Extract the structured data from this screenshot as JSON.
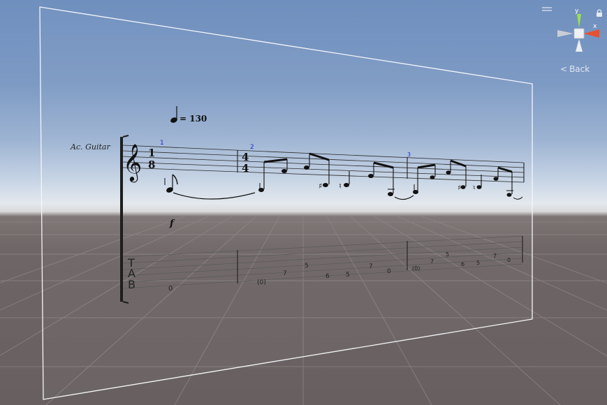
{
  "score": {
    "tempo_value": "= 130",
    "instrument_label": "Ac. Guitar",
    "first_time_signature": {
      "top": "1",
      "bottom": "8"
    },
    "second_time_signature": {
      "top": "4",
      "bottom": "4"
    },
    "measure_numbers": [
      "1",
      "2",
      "3"
    ],
    "dynamic_marking": "f",
    "tab_clef_letters": [
      "T",
      "A",
      "B"
    ],
    "tab_numbers_measure1": [
      "0"
    ],
    "tab_numbers_measure2": [
      "(0)",
      "7",
      "5",
      "6",
      "5",
      "7",
      "0"
    ],
    "tab_numbers_measure3": [
      "(0)",
      "7",
      "5",
      "6",
      "5",
      "7",
      "0"
    ]
  },
  "gizmo": {
    "y_axis_label": "y",
    "x_axis_label": "x",
    "back_label": "Back"
  },
  "colors": {
    "sky_top": "#6f8fbe",
    "horizon": "#e4e9ee",
    "ground": "#6e6666",
    "grid_line": "#8a8282",
    "measure_number": "#1a2bd0",
    "gizmo_x": "#e8502f",
    "gizmo_y": "#8ed943"
  },
  "icons": [
    "menu-icon",
    "lock-icon",
    "orientation-gizmo-icon",
    "back-chevron-icon"
  ]
}
